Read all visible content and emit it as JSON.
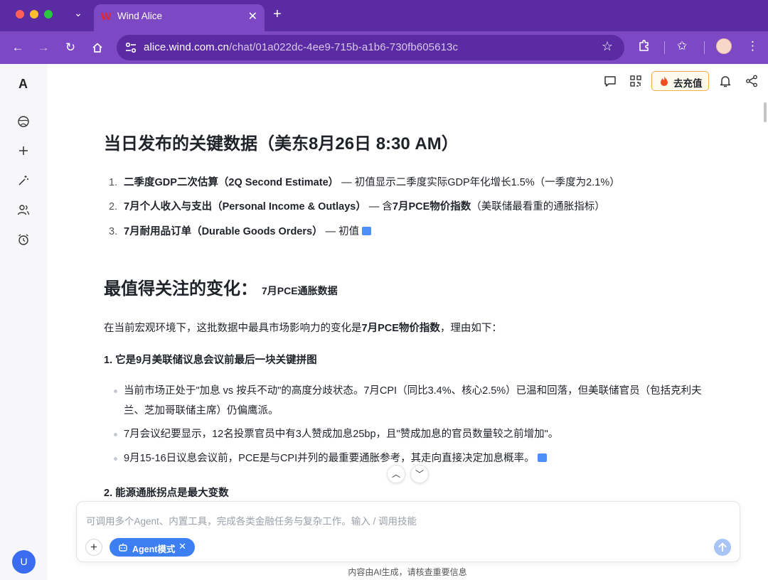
{
  "browser": {
    "tab_title": "Wind Alice",
    "tab_favicon": "W",
    "url_host": "alice.wind.com.cn",
    "url_path": "/chat/01a022dc-4ee9-715b-a1b6-730fb605613c"
  },
  "sidebar": {
    "brand": "A",
    "icons": [
      "explore-icon",
      "plus-icon",
      "magic-wand-icon",
      "users-icon",
      "alarm-clock-icon"
    ],
    "user_initial": "U"
  },
  "topbar": {
    "recharge_label": "去充值"
  },
  "article": {
    "heading1": "当日发布的关键数据（美东8月26日 8:30 AM）",
    "list": [
      {
        "num": "1.",
        "bold": "二季度GDP二次估算（2Q Second Estimate）",
        "rest": " — 初值显示二季度实际GDP年化增长1.5%（一季度为2.1%）"
      },
      {
        "num": "2.",
        "bold": "7月个人收入与支出（Personal Income & Outlays）",
        "rest_a": " — 含",
        "bold_b": "7月PCE物价指数",
        "rest_b": "（美联储最看重的通胀指标）"
      },
      {
        "num": "3.",
        "bold": "7月耐用品订单（Durable Goods Orders）",
        "rest": " — 初值"
      }
    ],
    "heading2_big": "最值得关注的变化：",
    "heading2_small": "7月PCE通胀数据",
    "intro_a": "在当前宏观环境下，这批数据中最具市场影响力的变化是",
    "intro_bold": "7月PCE物价指数",
    "intro_b": "，理由如下：",
    "section1": "1. 它是9月美联储议息会议前最后一块关键拼图",
    "bullets": [
      "当前市场正处于\"加息 vs 按兵不动\"的高度分歧状态。7月CPI（同比3.4%、核心2.5%）已温和回落，但美联储官员（包括克利夫兰、芝加哥联储主席）仍偏鹰派。",
      "7月会议纪要显示，12名投票官员中有3人赞成加息25bp，且\"赞成加息的官员数量较之前增加\"。",
      "9月15-16日议息会议前，PCE是与CPI并列的最重要通胀参考，其走向直接决定加息概率。"
    ],
    "section2": "2. 能源通胀拐点是最大变数"
  },
  "composer": {
    "placeholder": "可调用多个Agent、内置工具，完成各类金融任务与复杂工作。输入 / 调用技能",
    "agent_mode_label": "Agent模式"
  },
  "footer": {
    "disclaimer": "内容由AI生成，请核查重要信息"
  },
  "colors": {
    "browser_purple": "#7c48c4",
    "accent_blue": "#3b7ff2",
    "recharge_border": "#f0b04a"
  }
}
